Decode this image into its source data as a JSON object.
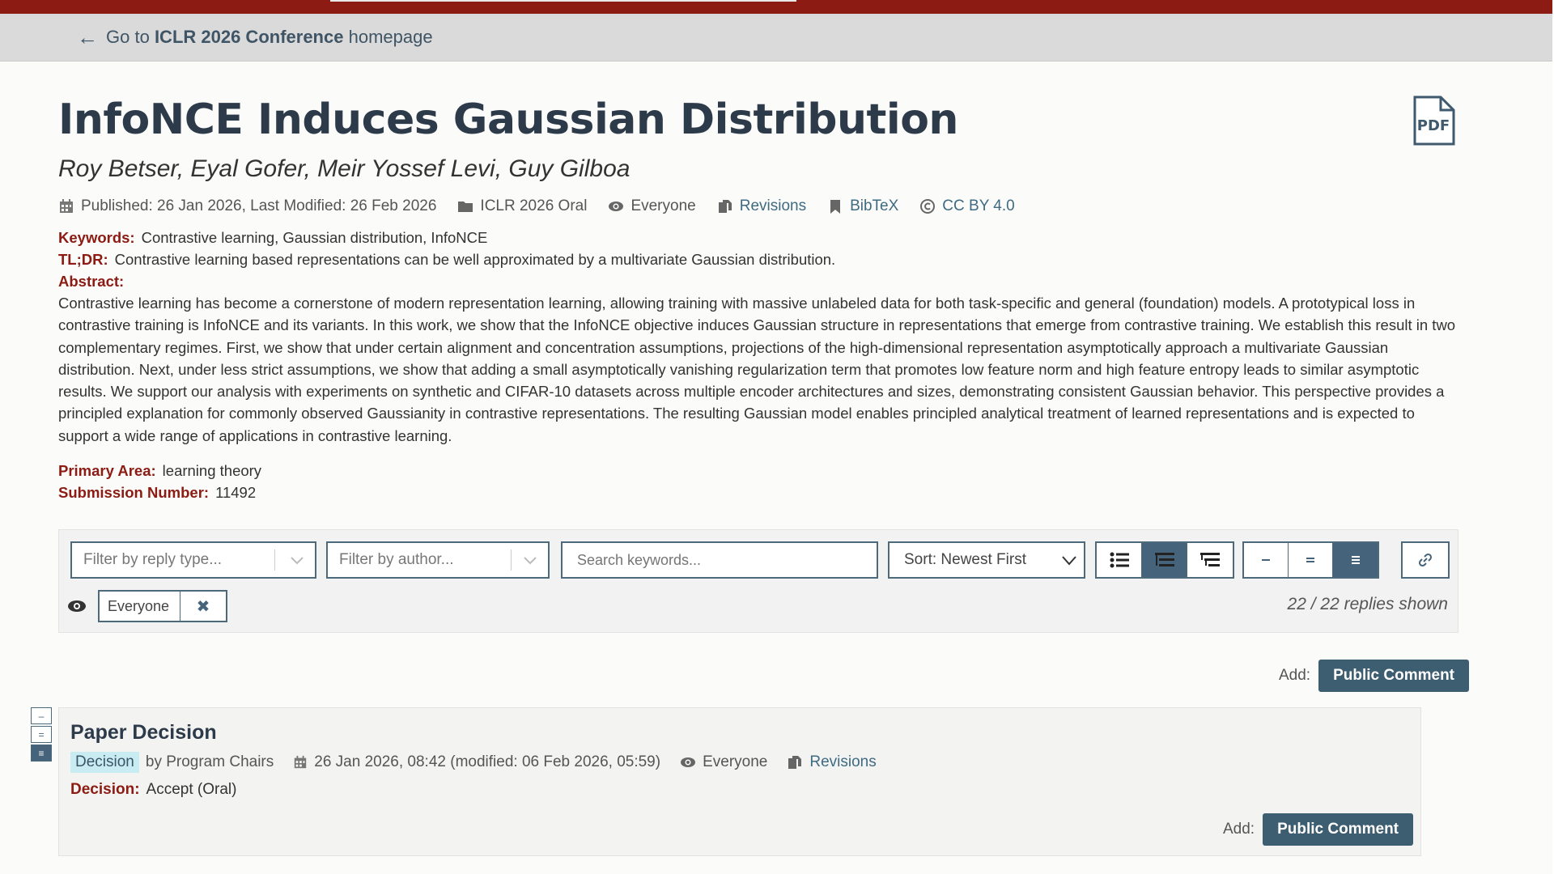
{
  "venue_bar": {
    "prefix": "Go to",
    "venue": "ICLR 2026 Conference",
    "suffix": "homepage"
  },
  "paper": {
    "title": "InfoNCE Induces Gaussian Distribution",
    "authors": "Roy Betser, Eyal Gofer, Meir Yossef Levi, Guy Gilboa",
    "meta": {
      "dates": "Published: 26 Jan 2026, Last Modified: 26 Feb 2026",
      "venue": "ICLR 2026 Oral",
      "readers": "Everyone",
      "revisions": "Revisions",
      "bibtex": "BibTeX",
      "license": "CC BY 4.0"
    },
    "keywords_label": "Keywords:",
    "keywords": "Contrastive learning, Gaussian distribution, InfoNCE",
    "tldr_label": "TL;DR:",
    "tldr": "Contrastive learning based representations can be well approximated by a multivariate Gaussian distribution.",
    "abstract_label": "Abstract:",
    "abstract": "Contrastive learning has become a cornerstone of modern representation learning, allowing training with massive unlabeled data for both task-specific and general (foundation) models. A prototypical loss in contrastive training is InfoNCE and its variants. In this work, we show that the InfoNCE objective induces Gaussian structure in representations that emerge from contrastive training. We establish this result in two complementary regimes. First, we show that under certain alignment and concentration assumptions, projections of the high-dimensional representation asymptotically approach a multivariate Gaussian distribution. Next, under less strict assumptions, we show that adding a small asymptotically vanishing regularization term that promotes low feature norm and high feature entropy leads to similar asymptotic results. We support our analysis with experiments on synthetic and CIFAR-10 datasets across multiple encoder architectures and sizes, demonstrating consistent Gaussian behavior. This perspective provides a principled explanation for commonly observed Gaussianity in contrastive representations. The resulting Gaussian model enables principled analytical treatment of learned representations and is expected to support a wide range of applications in contrastive learning.",
    "primary_area_label": "Primary Area:",
    "primary_area": "learning theory",
    "submission_number_label": "Submission Number:",
    "submission_number": "11492"
  },
  "filters": {
    "reply_type_placeholder": "Filter by reply type...",
    "author_placeholder": "Filter by author...",
    "search_placeholder": "Search keywords...",
    "sort_value": "Sort: Newest First",
    "readers_chip": "Everyone",
    "chip_remove": "✖",
    "replies_shown": "22 / 22 replies shown"
  },
  "add_comment": {
    "label": "Add:",
    "button": "Public Comment"
  },
  "decision_note": {
    "title": "Paper Decision",
    "badge": "Decision",
    "signature": "by Program Chairs",
    "date": "26 Jan 2026, 08:42 (modified: 06 Feb 2026, 05:59)",
    "readers": "Everyone",
    "revisions": "Revisions",
    "decision_label": "Decision:",
    "decision_value": "Accept (Oral)",
    "add_label": "Add:",
    "add_button": "Public Comment"
  },
  "colors": {
    "brand_red": "#8c1b13",
    "button_blue": "#3d5d70",
    "label_red": "#8c1b13",
    "badge_bg": "#c9ecf3"
  },
  "icons": [
    "arrow-left-icon",
    "pdf-icon",
    "calendar-icon",
    "folder-icon",
    "eye-icon",
    "revisions-icon",
    "bookmark-icon",
    "copyright-icon",
    "chevron-down-icon",
    "list-icon",
    "threaded-icon",
    "nested-icon",
    "link-icon"
  ]
}
